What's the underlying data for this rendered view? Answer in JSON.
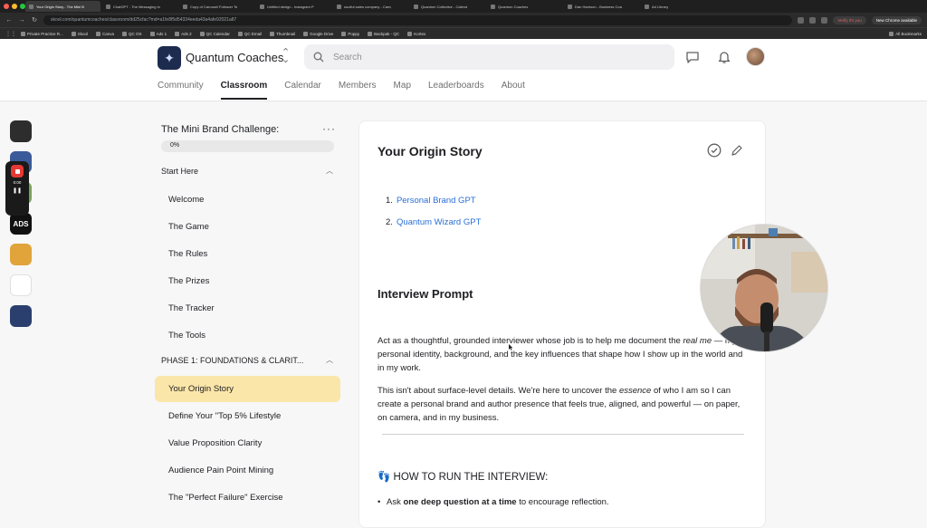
{
  "browser": {
    "tabs": [
      {
        "label": "Your Origin Story - The Mini B",
        "active": true
      },
      {
        "label": "ChatGPT - The Messaging In",
        "active": false
      },
      {
        "label": "Copy of Carousel Follower Te",
        "active": false
      },
      {
        "label": "Untitled design - Instagram P",
        "active": false
      },
      {
        "label": "soulful sales company - Canv",
        "active": false
      },
      {
        "label": "Quantum Collective - Calend",
        "active": false
      },
      {
        "label": "Quantum Coaches",
        "active": false
      },
      {
        "label": "Dan Harrison - Business Coa",
        "active": false
      },
      {
        "label": "Ad Library",
        "active": false
      }
    ],
    "url": "skool.com/quantumcoaches/classroom/dd25cfac?md=a1fe8f5d54334eeda43a4afe92021a87",
    "verify_label": "Verify it's you",
    "new_chrome_label": "New Chrome available",
    "bookmarks": [
      "Private Practice R...",
      "Skool",
      "Canva",
      "QC OS",
      "Ads 1",
      "Ads 2",
      "QC Calendar",
      "QC Email",
      "Thumbnail",
      "Google Drive",
      "Poppy",
      "Backpak - QC",
      "Kortex"
    ],
    "all_bookmarks_label": "All Bookmarks"
  },
  "header": {
    "community_name": "Quantum Coaches",
    "search_placeholder": "Search",
    "tabs": [
      "Community",
      "Classroom",
      "Calendar",
      "Members",
      "Map",
      "Leaderboards",
      "About"
    ],
    "active_tab": "Classroom"
  },
  "sidebar": {
    "strip_items": [
      {
        "label": "",
        "color": "#2d2d2d"
      },
      {
        "label": "",
        "color": "#3b5a9a"
      },
      {
        "label": "",
        "color": "#7aa35a"
      },
      {
        "label": "ADS",
        "color": "#111111"
      },
      {
        "label": "",
        "color": "#e0a43a"
      },
      {
        "label": "",
        "color": "#ffffff"
      },
      {
        "label": "",
        "color": "#2b3f6e"
      }
    ],
    "recorder_time": "0:00",
    "course_title": "The Mini Brand Challenge:",
    "progress_label": "0%",
    "progress_value": 0,
    "sections": [
      {
        "title": "Start Here",
        "lessons": [
          "Welcome",
          "The Game",
          "The Rules",
          "The Prizes",
          "The Tracker",
          "The Tools"
        ]
      },
      {
        "title": "PHASE 1: FOUNDATIONS & CLARIT...",
        "lessons": [
          "Your Origin Story",
          "Define Your \"Top 5% Lifestyle",
          "Value Proposition Clarity",
          "Audience Pain Point Mining",
          "The \"Perfect Failure\" Exercise"
        ]
      }
    ],
    "active_lesson": "Your Origin Story"
  },
  "lesson": {
    "title": "Your Origin Story",
    "links": [
      {
        "number": "1.",
        "label": "Personal Brand GPT"
      },
      {
        "number": "2.",
        "label": "Quantum Wizard GPT"
      }
    ],
    "interview_heading": "Interview Prompt",
    "para1_a": "Act as a thoughtful, grounded interviewer whose job is to help me document the ",
    "para1_em": "real me",
    "para1_b": " — my personal identity, background, and the key influences that shape how I show up in the world and in my work.",
    "para2_a": "This isn't about surface-level details. We're here to uncover the ",
    "para2_em": "essence",
    "para2_b": " of who I am so I can create a personal brand and author presence that feels true, aligned, and powerful — on paper, on camera, and in my business.",
    "how_heading": "👣 HOW TO RUN THE INTERVIEW:",
    "bullet_a": "Ask ",
    "bullet_bold": "one deep question at a time",
    "bullet_b": " to encourage reflection."
  },
  "colors": {
    "active_lesson_bg": "#fbe6a9",
    "link": "#2b6fd6",
    "record": "#e53935"
  }
}
